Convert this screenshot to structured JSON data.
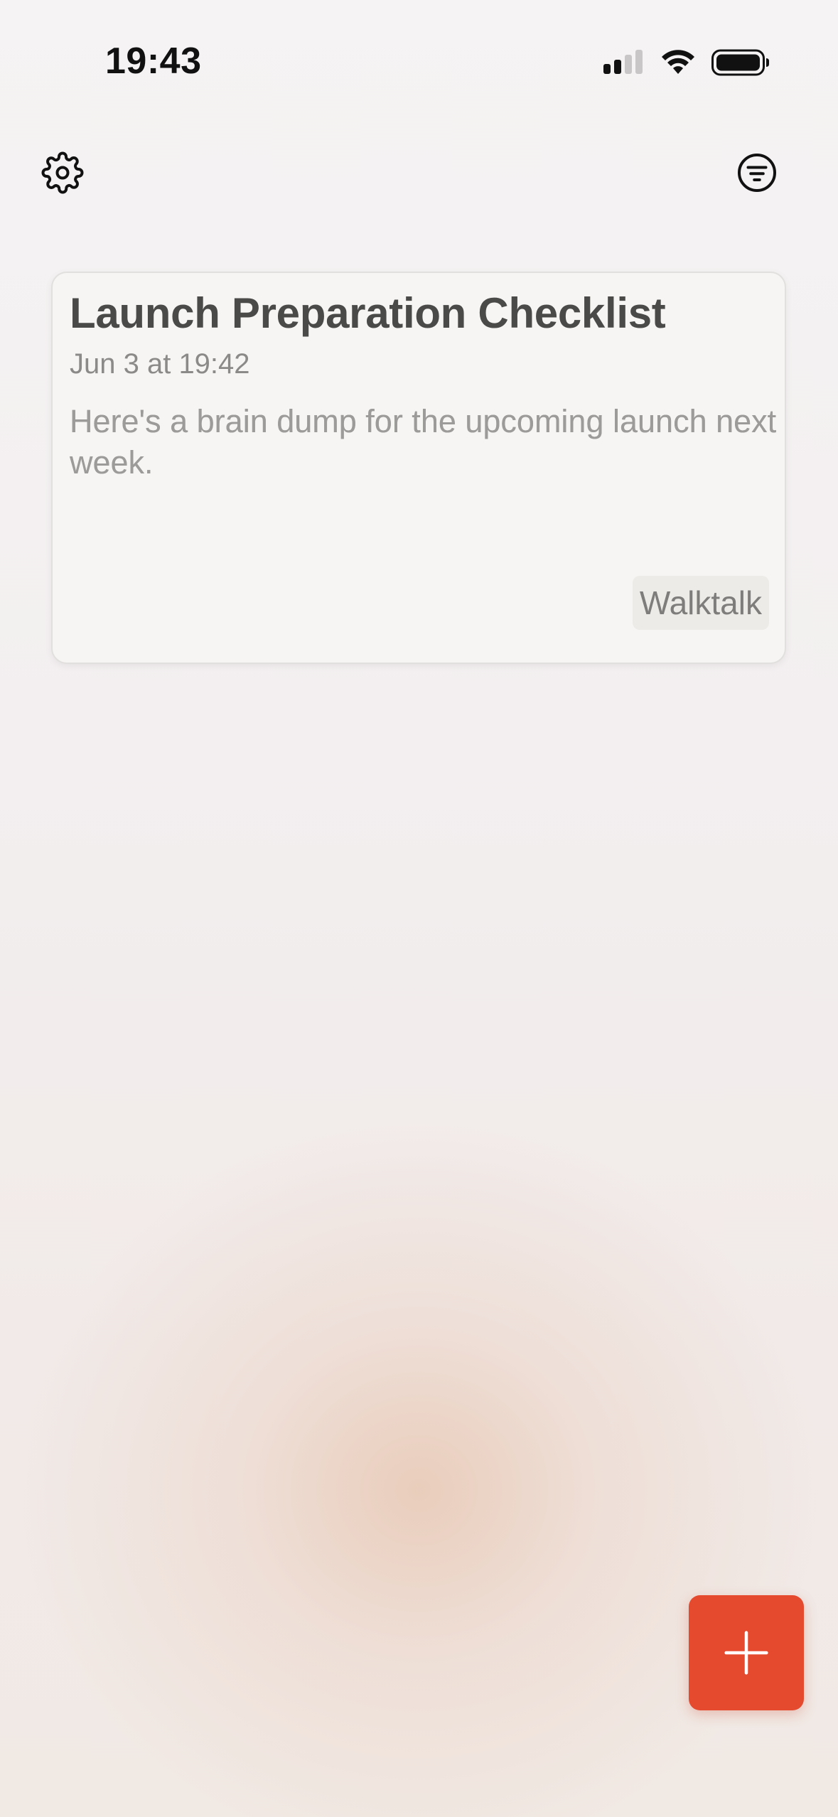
{
  "status_bar": {
    "time": "19:43",
    "icons": [
      "cellular-signal-icon",
      "wifi-icon",
      "battery-icon"
    ]
  },
  "toolbar": {
    "left_icon": "gear-icon",
    "right_icon": "filter-lines-icon"
  },
  "notes": [
    {
      "title": "Launch Preparation Checklist",
      "date": "Jun 3 at 19:42",
      "preview": "Here's a brain dump for the upcoming launch next week.",
      "tag": "Walktalk"
    }
  ],
  "fab": {
    "icon": "plus-icon"
  },
  "colors": {
    "accent": "#e5492e",
    "card_background": "#f6f5f3",
    "title_text": "#4a4a48",
    "muted_text": "#8c8a88"
  }
}
